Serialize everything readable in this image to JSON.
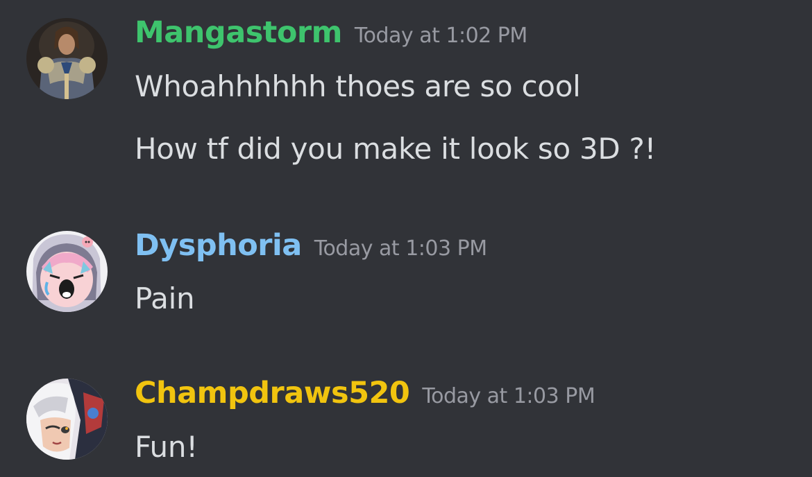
{
  "colors": {
    "background": "#313338",
    "message_text": "#dbdee1",
    "timestamp": "#989aa2"
  },
  "messages": [
    {
      "username": "Mangastorm",
      "username_color": "#3ec46d",
      "timestamp": "Today at 1:02 PM",
      "avatar_icon": "armored-knight-avatar",
      "lines": [
        "Whoahhhhhh thoes are so cool",
        "How tf did you make it look so 3D ?!"
      ]
    },
    {
      "username": "Dysphoria",
      "username_color": "#7fc0f2",
      "timestamp": "Today at 1:03 PM",
      "avatar_icon": "screaming-anime-girl-avatar",
      "lines": [
        "Pain"
      ]
    },
    {
      "username": "Champdraws520",
      "username_color": "#f1c40f",
      "timestamp": "Today at 1:03 PM",
      "avatar_icon": "white-haired-anime-character-avatar",
      "lines": [
        "Fun!"
      ]
    }
  ]
}
